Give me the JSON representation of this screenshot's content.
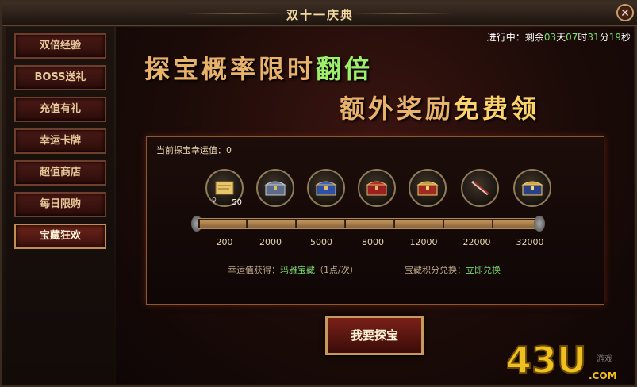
{
  "window": {
    "title": "双十一庆典",
    "close_label": "✕"
  },
  "sidebar": {
    "items": [
      {
        "label": "双倍经验",
        "active": false
      },
      {
        "label": "BOSS送礼",
        "active": false
      },
      {
        "label": "充值有礼",
        "active": false
      },
      {
        "label": "幸运卡牌",
        "active": false
      },
      {
        "label": "超值商店",
        "active": false
      },
      {
        "label": "每日限购",
        "active": false
      },
      {
        "label": "宝藏狂欢",
        "active": true
      }
    ]
  },
  "countdown": {
    "prefix": "进行中：剩余",
    "days": "03",
    "days_unit": "天",
    "hours": "07",
    "hours_unit": "时",
    "minutes": "31",
    "minutes_unit": "分",
    "seconds": "19",
    "seconds_unit": "秒"
  },
  "slogan": {
    "line1_a": "探宝概率限时",
    "line1_b": "翻倍",
    "line2_a": "额外奖励",
    "line2_b": "免费领"
  },
  "panel": {
    "luck_label": "当前探宝幸运值：0",
    "items": [
      {
        "name": "scroll-reward-icon",
        "qty": "50",
        "gender": "♀"
      },
      {
        "name": "silver-chest-icon"
      },
      {
        "name": "blue-chest-icon"
      },
      {
        "name": "red-chest-icon"
      },
      {
        "name": "red-gold-chest-icon"
      },
      {
        "name": "crossed-sticks-icon"
      },
      {
        "name": "gold-chest-icon"
      }
    ],
    "ticks": [
      "200",
      "2000",
      "5000",
      "8000",
      "12000",
      "22000",
      "32000"
    ],
    "luck_get_label": "幸运值获得：",
    "luck_get_link": "玛雅宝藏",
    "luck_get_suffix": "（1点/次）",
    "exchange_label": "宝藏积分兑换：",
    "exchange_link": "立即兑换"
  },
  "treasure_button": "我要探宝",
  "watermark": {
    "main": "43U",
    "sub": ".COM",
    "small": "游戏"
  },
  "colors": {
    "accent_green": "#78d66a",
    "gold": "#e9b26a",
    "dark_red": "#3a0c08"
  }
}
